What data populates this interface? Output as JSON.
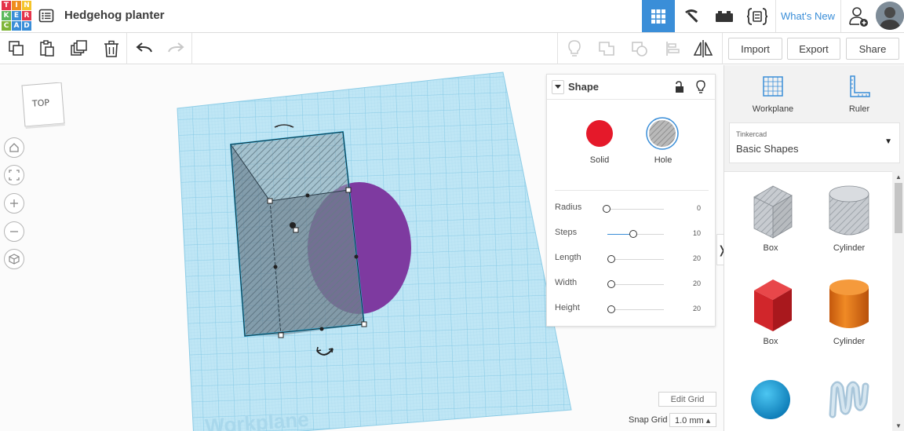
{
  "app": {
    "logo_letters": [
      "T",
      "I",
      "N",
      "K",
      "E",
      "R",
      "C",
      "A",
      "D"
    ],
    "logo_colors": [
      "#e4334a",
      "#ef8d1f",
      "#f4c42a",
      "#5cb85c",
      "#3a8ed8",
      "#e4334a",
      "#7fb539",
      "#3a8ed8",
      "#3a8ed8"
    ],
    "title": "Hedgehog planter"
  },
  "topbar": {
    "whats_new": "What's New"
  },
  "toolbar": {
    "import_label": "Import",
    "export_label": "Export",
    "share_label": "Share"
  },
  "viewport": {
    "viewcube_label": "TOP",
    "workplane_watermark": "Workplane",
    "edit_grid_label": "Edit Grid",
    "snap_grid_label": "Snap Grid",
    "snap_grid_value": "1.0 mm ▴"
  },
  "inspector": {
    "title": "Shape",
    "solid_label": "Solid",
    "hole_label": "Hole",
    "solid_color": "#e5192a",
    "params": [
      {
        "label": "Radius",
        "value": "0"
      },
      {
        "label": "Steps",
        "value": "10"
      },
      {
        "label": "Length",
        "value": "20"
      },
      {
        "label": "Width",
        "value": "20"
      },
      {
        "label": "Height",
        "value": "20"
      }
    ]
  },
  "right_panel": {
    "workplane_label": "Workplane",
    "ruler_label": "Ruler",
    "library_small": "Tinkercad",
    "library_name": "Basic Shapes",
    "shapes": [
      {
        "label": "Box",
        "icon": "box-hole-icon"
      },
      {
        "label": "Cylinder",
        "icon": "cylinder-hole-icon"
      },
      {
        "label": "Box",
        "icon": "box-solid-icon"
      },
      {
        "label": "Cylinder",
        "icon": "cylinder-solid-icon"
      },
      {
        "label": "",
        "icon": "sphere-icon"
      },
      {
        "label": "",
        "icon": "scribble-icon"
      }
    ]
  }
}
